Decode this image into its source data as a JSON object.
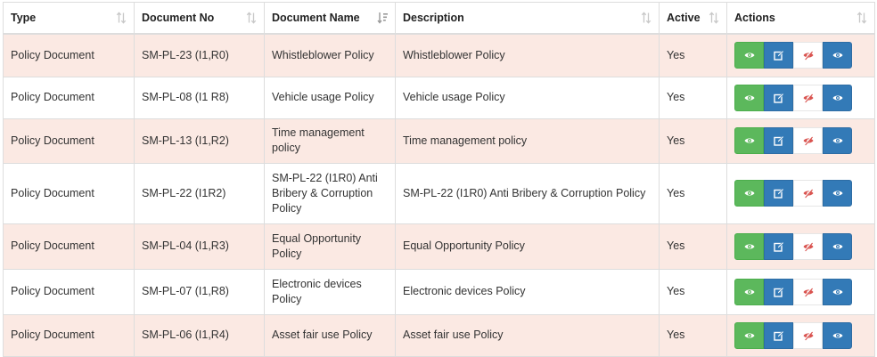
{
  "table": {
    "columns": [
      {
        "label": "Type",
        "sort": "both"
      },
      {
        "label": "Document No",
        "sort": "both"
      },
      {
        "label": "Document Name",
        "sort": "desc"
      },
      {
        "label": "Description",
        "sort": "both"
      },
      {
        "label": "Active",
        "sort": "both"
      },
      {
        "label": "Actions",
        "sort": "both"
      }
    ],
    "rows": [
      {
        "type": "Policy Document",
        "doc_no": "SM-PL-23 (I1,R0)",
        "name": "Whistleblower Policy",
        "description": "Whistleblower Policy",
        "active": "Yes"
      },
      {
        "type": "Policy Document",
        "doc_no": "SM-PL-08 (I1 R8)",
        "name": "Vehicle usage Policy",
        "description": "Vehicle usage Policy",
        "active": "Yes"
      },
      {
        "type": "Policy Document",
        "doc_no": "SM-PL-13 (I1,R2)",
        "name": "Time management policy",
        "description": "Time management policy",
        "active": "Yes"
      },
      {
        "type": "Policy Document",
        "doc_no": "SM-PL-22 (I1R2)",
        "name": "SM-PL-22 (I1R0) Anti Bribery & Corruption Policy",
        "description": "SM-PL-22 (I1R0) Anti Bribery & Corruption Policy",
        "active": "Yes"
      },
      {
        "type": "Policy Document",
        "doc_no": "SM-PL-04 (I1,R3)",
        "name": "Equal Opportunity Policy",
        "description": "Equal Opportunity Policy",
        "active": "Yes"
      },
      {
        "type": "Policy Document",
        "doc_no": "SM-PL-07 (I1,R8)",
        "name": "Electronic devices Policy",
        "description": "Electronic devices Policy",
        "active": "Yes"
      },
      {
        "type": "Policy Document",
        "doc_no": "SM-PL-06 (I1,R4)",
        "name": "Asset fair use Policy",
        "description": "Asset fair use Policy",
        "active": "Yes"
      }
    ]
  },
  "action_buttons": [
    {
      "icon": "eye-icon",
      "style": "green"
    },
    {
      "icon": "edit-icon",
      "style": "blue"
    },
    {
      "icon": "eye-slash-icon",
      "style": "white"
    },
    {
      "icon": "eye-icon",
      "style": "blue"
    }
  ],
  "colors": {
    "row_stripe": "#fbe9e3",
    "green": "#5cb85c",
    "blue": "#337ab7",
    "deactivate_red": "#d9534f",
    "sort_icon": "#c8c8c8"
  }
}
